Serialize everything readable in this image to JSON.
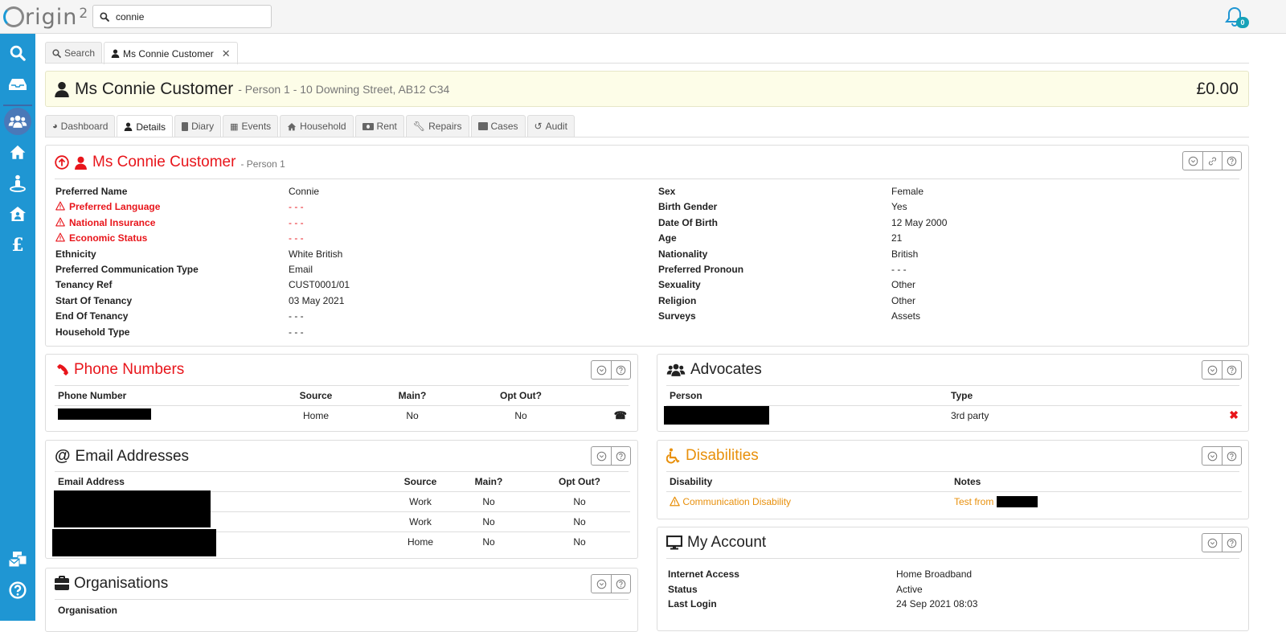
{
  "app": {
    "logo_text": "rigin",
    "logo_sup": "2",
    "search_value": "connie",
    "notification_count": "0"
  },
  "sidebar": {
    "items": [
      {
        "name": "search",
        "icon": "search-icon"
      },
      {
        "name": "inbox",
        "icon": "inbox-icon"
      },
      {
        "name": "people",
        "icon": "users-icon",
        "active": true
      },
      {
        "name": "properties",
        "icon": "home-icon"
      },
      {
        "name": "person-location",
        "icon": "person-pin-icon"
      },
      {
        "name": "house-user",
        "icon": "house-user-icon"
      },
      {
        "name": "finance",
        "icon": "pound-icon"
      },
      {
        "name": "messages",
        "icon": "mail-bulk-icon"
      },
      {
        "name": "help",
        "icon": "help-icon"
      }
    ]
  },
  "top_tabs": [
    {
      "label": "Search",
      "icon": "search-icon"
    },
    {
      "label": "Ms Connie Customer",
      "icon": "user-icon",
      "closable": true,
      "active": true
    }
  ],
  "header": {
    "name": "Ms Connie Customer",
    "subtitle": "- Person 1 - 10 Downing Street, AB12 C34",
    "balance": "£0.00"
  },
  "section_tabs": [
    {
      "label": "Dashboard",
      "icon": "pie-chart-icon"
    },
    {
      "label": "Details",
      "icon": "user-icon",
      "active": true
    },
    {
      "label": "Diary",
      "icon": "book-icon"
    },
    {
      "label": "Events",
      "icon": "calendar-icon"
    },
    {
      "label": "Household",
      "icon": "home-icon"
    },
    {
      "label": "Rent",
      "icon": "money-icon"
    },
    {
      "label": "Repairs",
      "icon": "wrench-icon"
    },
    {
      "label": "Cases",
      "icon": "briefcase-icon"
    },
    {
      "label": "Audit",
      "icon": "history-icon"
    }
  ],
  "person": {
    "title": "Ms Connie Customer",
    "subtitle": "- Person 1",
    "left": [
      {
        "label": "Preferred Name",
        "value": "Connie"
      },
      {
        "label": "Preferred Language",
        "value": "- - -",
        "warning": true
      },
      {
        "label": "National Insurance",
        "value": "- - -",
        "warning": true
      },
      {
        "label": "Economic Status",
        "value": "- - -",
        "warning": true
      },
      {
        "label": "Ethnicity",
        "value": "White British"
      },
      {
        "label": "Preferred Communication Type",
        "value": "Email"
      },
      {
        "label": "Tenancy Ref",
        "value": "CUST0001/01"
      },
      {
        "label": "Start Of Tenancy",
        "value": "03 May 2021"
      },
      {
        "label": "End Of Tenancy",
        "value": "- - -"
      },
      {
        "label": "Household Type",
        "value": "- - -"
      }
    ],
    "right": [
      {
        "label": "Sex",
        "value": "Female"
      },
      {
        "label": "Birth Gender",
        "value": "Yes"
      },
      {
        "label": "Date Of Birth",
        "value": "12 May 2000"
      },
      {
        "label": "Age",
        "value": "21"
      },
      {
        "label": "Nationality",
        "value": "British"
      },
      {
        "label": "Preferred Pronoun",
        "value": "- - -"
      },
      {
        "label": "Sexuality",
        "value": "Other"
      },
      {
        "label": "Religion",
        "value": "Other"
      },
      {
        "label": "Surveys",
        "value": "Assets"
      }
    ]
  },
  "phones": {
    "title": "Phone Numbers",
    "headers": [
      "Phone Number",
      "Source",
      "Main?",
      "Opt Out?"
    ],
    "rows": [
      {
        "number": "",
        "source": "Home",
        "main": "No",
        "opt_out": "No"
      }
    ]
  },
  "emails": {
    "title": "Email Addresses",
    "headers": [
      "Email Address",
      "Source",
      "Main?",
      "Opt Out?"
    ],
    "rows": [
      {
        "email": "",
        "source": "Work",
        "main": "No",
        "opt_out": "No"
      },
      {
        "email": "",
        "source": "Work",
        "main": "No",
        "opt_out": "No"
      },
      {
        "email": "",
        "source": "Home",
        "main": "No",
        "opt_out": "No"
      }
    ]
  },
  "organisations": {
    "title": "Organisations",
    "headers": [
      "Organisation"
    ]
  },
  "advocates": {
    "title": "Advocates",
    "headers": [
      "Person",
      "Type"
    ],
    "rows": [
      {
        "person": "",
        "type": "3rd party"
      }
    ]
  },
  "disabilities": {
    "title": "Disabilities",
    "headers": [
      "Disability",
      "Notes"
    ],
    "rows": [
      {
        "disability": "Communication Disability",
        "notes": "Test from"
      }
    ]
  },
  "account": {
    "title": "My Account",
    "rows": [
      {
        "label": "Internet Access",
        "value": "Home Broadband"
      },
      {
        "label": "Status",
        "value": "Active"
      },
      {
        "label": "Last Login",
        "value": "24 Sep 2021 08:03"
      }
    ]
  },
  "colors": {
    "sidebar": "#1f96d3",
    "alert": "#e8151b",
    "warning": "#e8900c",
    "header_bg": "#fdfde8"
  }
}
